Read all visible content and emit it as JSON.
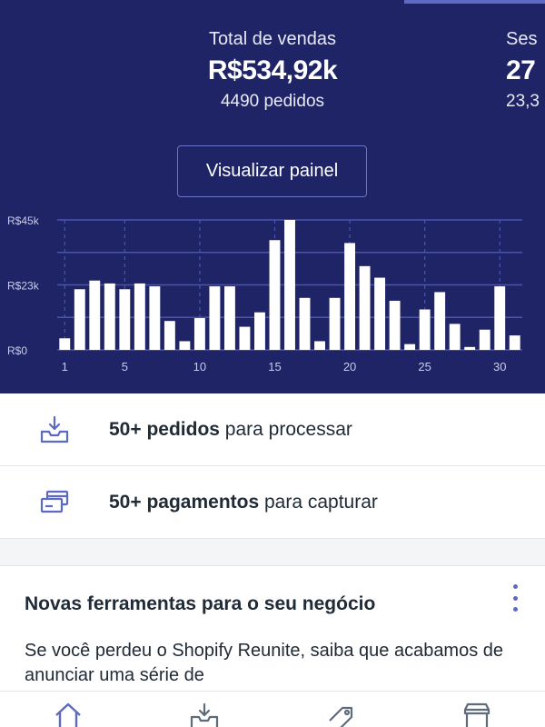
{
  "metrics": {
    "sales": {
      "label": "Total de vendas",
      "value": "R$534,92k",
      "sub": "4490 pedidos"
    },
    "sessions": {
      "label": "Ses",
      "value": "27",
      "sub": "23,3"
    }
  },
  "actions": {
    "view_dashboard": "Visualizar painel"
  },
  "chart_data": {
    "type": "bar",
    "categories": [
      "1",
      "2",
      "3",
      "4",
      "5",
      "6",
      "7",
      "8",
      "9",
      "10",
      "11",
      "12",
      "13",
      "14",
      "15",
      "16",
      "17",
      "18",
      "19",
      "20",
      "21",
      "22",
      "23",
      "24",
      "25",
      "26",
      "27",
      "28",
      "29",
      "30",
      "31"
    ],
    "values": [
      4,
      21,
      24,
      23,
      21,
      23,
      22,
      10,
      3,
      11,
      22,
      22,
      8,
      13,
      38,
      45,
      18,
      3,
      18,
      37,
      29,
      25,
      17,
      2,
      14,
      20,
      9,
      1,
      7,
      22,
      5
    ],
    "xticks": [
      "1",
      "5",
      "10",
      "15",
      "20",
      "25",
      "30"
    ],
    "yticks": [
      "R$0",
      "R$23k",
      "R$45k"
    ],
    "ylim": [
      0,
      45
    ],
    "grid": true,
    "colors": {
      "bar": "#ffffff",
      "grid": "#4a54b0",
      "text": "#c9cce8"
    }
  },
  "tasks": [
    {
      "bold": "50+ pedidos",
      "rest": " para processar",
      "icon": "inbox-download-icon"
    },
    {
      "bold": "50+ pagamentos",
      "rest": " para capturar",
      "icon": "payment-cards-icon"
    }
  ],
  "card": {
    "title": "Novas ferramentas para o seu negócio",
    "body": "Se você perdeu o Shopify Reunite, saiba que acabamos de anunciar uma série de"
  },
  "nav": [
    "home-icon",
    "orders-icon",
    "products-tag-icon",
    "store-icon"
  ],
  "theme": {
    "hero_bg": "#1e2466",
    "accent": "#5c6ac4"
  }
}
